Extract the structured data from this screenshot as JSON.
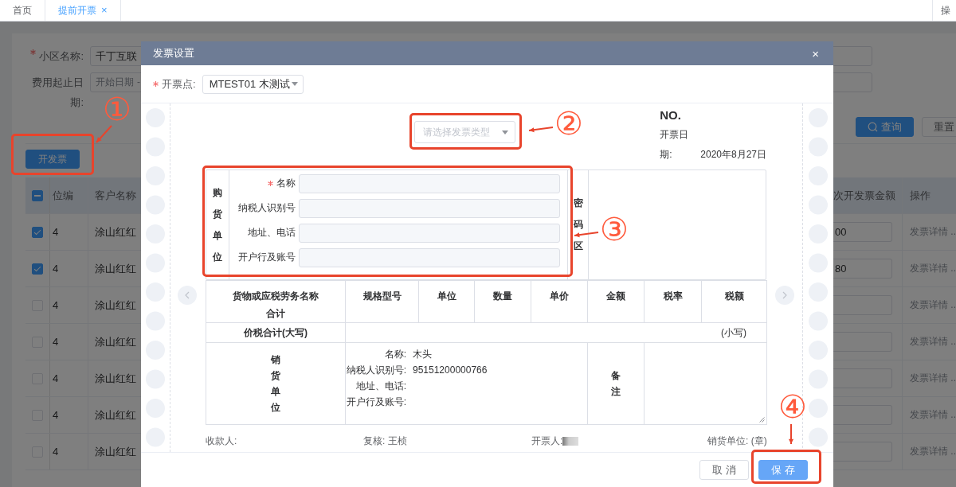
{
  "tabs": [
    {
      "label": "首页",
      "selected": false
    },
    {
      "label": "提前开票",
      "selected": true,
      "close": "×"
    }
  ],
  "tab_bar_right": "操",
  "filters": [
    {
      "label": "小区名称:",
      "required": true,
      "value": "千丁互联"
    },
    {
      "label": "费用起止日期:",
      "required": false,
      "placeholder": "开始日期",
      "separator": "-"
    }
  ],
  "search_buttons": [
    {
      "label": "查询",
      "kind": "primary"
    },
    {
      "label": "重置",
      "kind": "default"
    }
  ],
  "action_button": "开发票",
  "table": {
    "select_all_indeterminate": true,
    "columns": [
      "位编",
      "客户名称",
      "次开发票金额",
      "操作"
    ],
    "rows": [
      {
        "selected": true,
        "code": "4",
        "customer": "涂山红红",
        "amount": "00",
        "action": "发票详情 .."
      },
      {
        "selected": true,
        "code": "4",
        "customer": "涂山红红",
        "amount": "80",
        "action": "发票详情 .."
      },
      {
        "selected": false,
        "code": "4",
        "customer": "涂山红红",
        "action": "发票详情 .."
      },
      {
        "selected": false,
        "code": "4",
        "customer": "涂山红红",
        "action": "发票详情 .."
      },
      {
        "selected": false,
        "code": "4",
        "customer": "涂山红红",
        "action": "发票详情 .."
      },
      {
        "selected": false,
        "code": "4",
        "customer": "涂山红红",
        "action": "发票详情 .."
      },
      {
        "selected": false,
        "code": "4",
        "customer": "涂山红红",
        "action": "发票详情 .."
      }
    ]
  },
  "dialog": {
    "title": "发票设置",
    "close": "×",
    "point": {
      "label": "开票点:",
      "required": true,
      "value": "MTEST01 木测试"
    },
    "invoice": {
      "type_placeholder": "请选择发票类型",
      "no_label": "NO.",
      "date_label": "开票日期:",
      "date": "2020年8月27日",
      "buyer": {
        "title": "购货单位",
        "fields": [
          {
            "label": "名称",
            "required": true
          },
          {
            "label": "纳税人识别号",
            "required": false
          },
          {
            "label": "地址、电话",
            "required": false
          },
          {
            "label": "开户行及账号",
            "required": false
          }
        ]
      },
      "cipher_title": "密码区",
      "goods_columns": [
        "货物或应税劳务名称",
        "规格型号",
        "单位",
        "数量",
        "单价",
        "金额",
        "税率",
        "税额"
      ],
      "goods_total": "合计",
      "total_row": {
        "label": "价税合计(大写)",
        "small": "(小写)"
      },
      "seller": {
        "title": "销货单位",
        "fields": [
          {
            "label": "名称:",
            "value": "木头"
          },
          {
            "label": "纳税人识别号:",
            "value": "95151200000766"
          },
          {
            "label": "地址、电话:"
          },
          {
            "label": "开户行及账号:"
          }
        ]
      },
      "remark_title": "备注",
      "signatures": [
        {
          "text": "收款人:",
          "redacted": false
        },
        {
          "text": "复核: 王桢",
          "redacted": false
        },
        {
          "text": "开票人:",
          "redacted": true
        },
        {
          "text": "销货单位: (章)",
          "redacted": false
        }
      ]
    },
    "buttons": [
      {
        "label": "取 消",
        "kind": "default"
      },
      {
        "label": "保 存",
        "kind": "primary"
      }
    ]
  },
  "annotations": [
    {
      "label": "①"
    },
    {
      "label": "②"
    },
    {
      "label": "③"
    },
    {
      "label": "④"
    }
  ]
}
